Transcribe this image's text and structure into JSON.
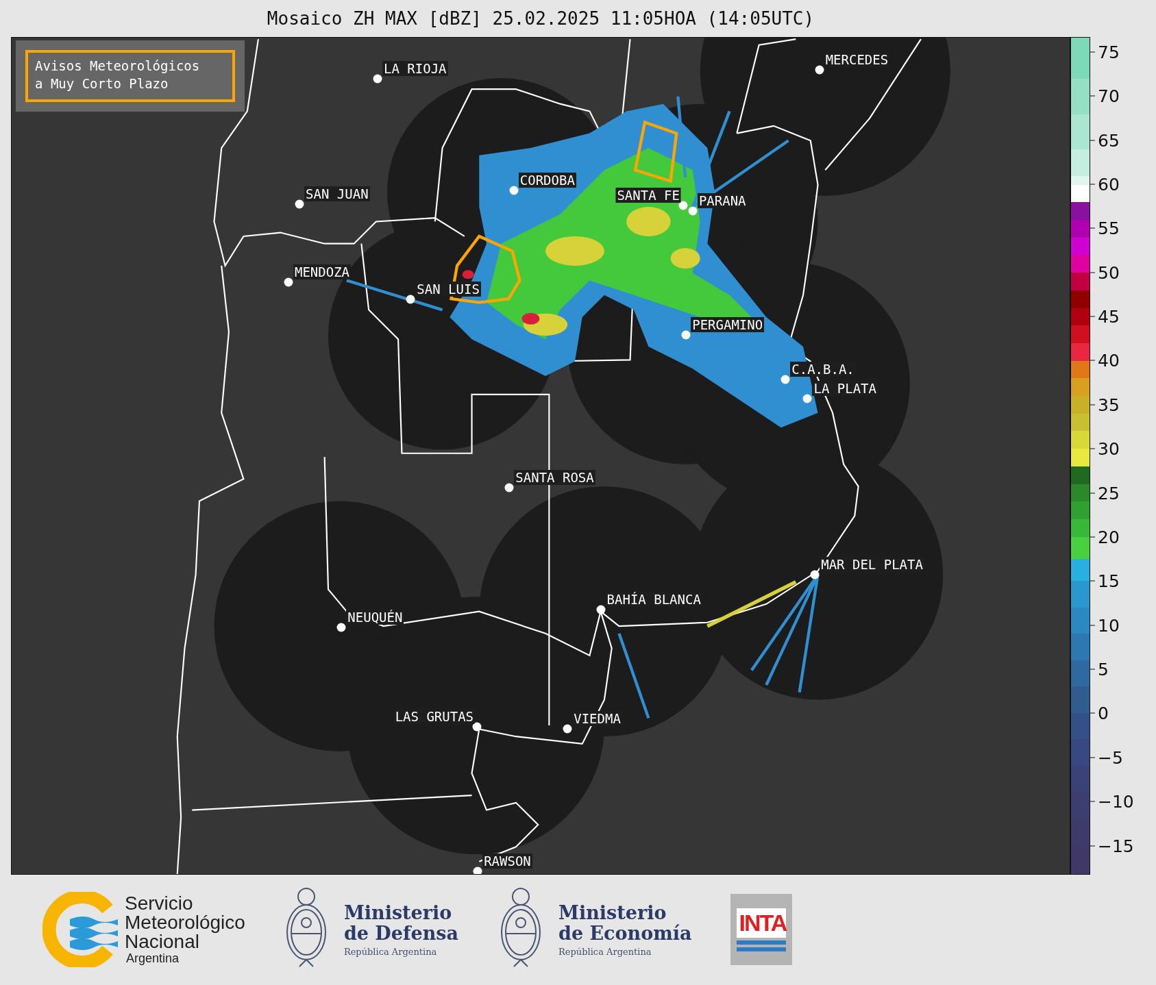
{
  "title": "Mosaico ZH MAX [dBZ] 25.02.2025 11:05HOA (14:05UTC)",
  "map": {
    "legend": {
      "lines": [
        "Avisos Meteorológicos",
        "a Muy Corto Plazo"
      ]
    },
    "cities": [
      "LA RIOJA",
      "MERCEDES",
      "CORDOBA",
      "SAN JUAN",
      "SANTA FE",
      "PARANA",
      "MENDOZA",
      "SAN LUIS",
      "PERGAMINO",
      "C.A.B.A.",
      "LA PLATA",
      "SANTA ROSA",
      "MAR DEL PLATA",
      "BAHÍA BLANCA",
      "NEUQUÉN",
      "LAS GRUTAS",
      "VIEDMA",
      "RAWSON"
    ]
  },
  "colorbar": {
    "ticks": [
      "75",
      "70",
      "65",
      "60",
      "55",
      "50",
      "45",
      "40",
      "35",
      "30",
      "25",
      "20",
      "15",
      "10",
      "5",
      "0",
      "−5",
      "−10",
      "−15"
    ]
  },
  "logos": [
    {
      "kind": "smn",
      "lines": [
        "Servicio",
        "Meteorológico",
        "Nacional"
      ],
      "subtitle": "Argentina"
    },
    {
      "kind": "ministry",
      "lines": [
        "Ministerio",
        "de Defensa"
      ],
      "subtitle": "República Argentina"
    },
    {
      "kind": "ministry",
      "lines": [
        "Ministerio",
        "de Economía"
      ],
      "subtitle": "República Argentina"
    },
    {
      "kind": "inta",
      "text": "INTA"
    }
  ]
}
